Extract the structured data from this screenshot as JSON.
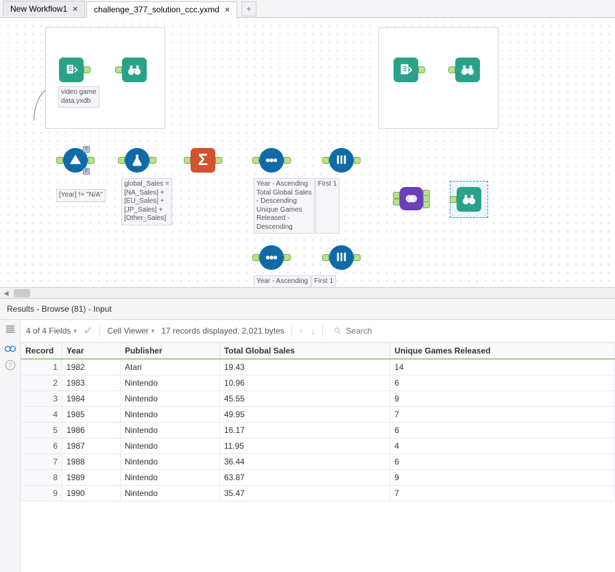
{
  "tabs": {
    "items": [
      {
        "label": "New Workflow1",
        "active": false
      },
      {
        "label": "challenge_377_solution_ccc.yxmd",
        "active": true
      }
    ],
    "add_tooltip": "New Workflow"
  },
  "canvas": {
    "input1_label": "video game\ndata.yxdb",
    "filter_label": "[Year] != \"N/A\"",
    "formula_label": "global_Sales =\n[NA_Sales] +\n[EU_Sales] +\n[JP_Sales] +\n[Other_Sales]",
    "sort1_label": "Year - Ascending\nTotal Global Sales\n- Descending\nUnique Games\nReleased -\nDescending",
    "sort1_badge": "First 1",
    "sort2_label": "Year - Ascending",
    "sort2_badge": "First 1"
  },
  "results": {
    "title": "Results - Browse (81) - Input",
    "field_count": "4 of 4 Fields",
    "cell_viewer": "Cell Viewer",
    "status": "17 records displayed, 2,021 bytes",
    "search_placeholder": "Search",
    "columns": [
      "Record",
      "Year",
      "Publisher",
      "Total Global Sales",
      "Unique Games Released"
    ],
    "rows": [
      {
        "rec": "1",
        "year": "1982",
        "pub": "Atari",
        "sales": "19.43",
        "games": "14"
      },
      {
        "rec": "2",
        "year": "1983",
        "pub": "Nintendo",
        "sales": "10.96",
        "games": "6"
      },
      {
        "rec": "3",
        "year": "1984",
        "pub": "Nintendo",
        "sales": "45.55",
        "games": "9"
      },
      {
        "rec": "4",
        "year": "1985",
        "pub": "Nintendo",
        "sales": "49.95",
        "games": "7"
      },
      {
        "rec": "5",
        "year": "1986",
        "pub": "Nintendo",
        "sales": "16.17",
        "games": "6"
      },
      {
        "rec": "6",
        "year": "1987",
        "pub": "Nintendo",
        "sales": "11.95",
        "games": "4"
      },
      {
        "rec": "7",
        "year": "1988",
        "pub": "Nintendo",
        "sales": "36.44",
        "games": "6"
      },
      {
        "rec": "8",
        "year": "1989",
        "pub": "Nintendo",
        "sales": "63.87",
        "games": "9"
      },
      {
        "rec": "9",
        "year": "1990",
        "pub": "Nintendo",
        "sales": "35.47",
        "games": "7"
      }
    ]
  }
}
